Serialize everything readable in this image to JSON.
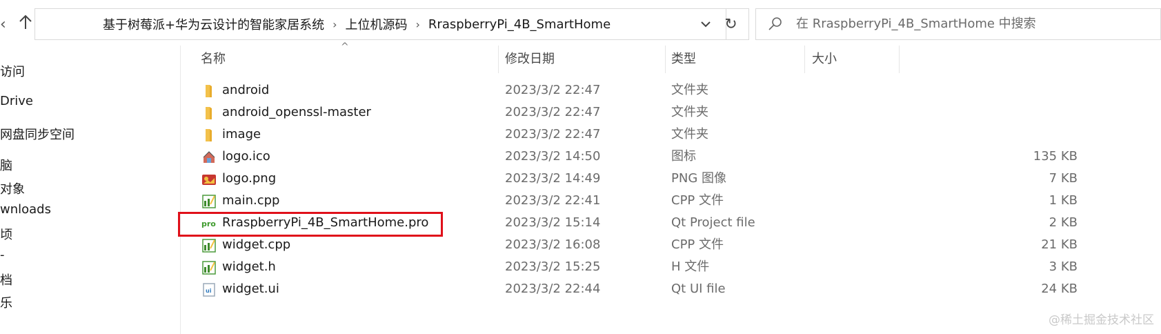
{
  "breadcrumb": {
    "items": [
      "基于树莓派+华为云设计的智能家居系统",
      "上位机源码",
      "RraspberryPi_4B_SmartHome"
    ],
    "separator": "›"
  },
  "search": {
    "placeholder": "在 RraspberryPi_4B_SmartHome 中搜索"
  },
  "icons": {
    "nav_up": "arrow-up-icon",
    "dropdown": "chevron-down-icon",
    "refresh": "refresh-icon",
    "search": "search-icon"
  },
  "nav_pane": {
    "items": [
      "访问",
      "Drive",
      "网盘同步空间",
      "脑",
      "对象",
      "wnloads",
      "顷",
      "-",
      "档",
      "乐"
    ]
  },
  "columns": {
    "name": "名称",
    "date": "修改日期",
    "type": "类型",
    "size": "大小"
  },
  "files": [
    {
      "name": "android",
      "date": "2023/3/2 22:47",
      "type": "文件夹",
      "size": "",
      "icon": "folder-icon"
    },
    {
      "name": "android_openssl-master",
      "date": "2023/3/2 22:47",
      "type": "文件夹",
      "size": "",
      "icon": "folder-icon"
    },
    {
      "name": "image",
      "date": "2023/3/2 22:47",
      "type": "文件夹",
      "size": "",
      "icon": "folder-icon"
    },
    {
      "name": "logo.ico",
      "date": "2023/3/2 14:50",
      "type": "图标",
      "size": "135 KB",
      "icon": "ico-file-icon"
    },
    {
      "name": "logo.png",
      "date": "2023/3/2 14:49",
      "type": "PNG 图像",
      "size": "7 KB",
      "icon": "png-file-icon"
    },
    {
      "name": "main.cpp",
      "date": "2023/3/2 22:41",
      "type": "CPP 文件",
      "size": "1 KB",
      "icon": "cpp-file-icon"
    },
    {
      "name": "RraspberryPi_4B_SmartHome.pro",
      "date": "2023/3/2 15:14",
      "type": "Qt Project file",
      "size": "2 KB",
      "icon": "pro-file-icon"
    },
    {
      "name": "widget.cpp",
      "date": "2023/3/2 16:08",
      "type": "CPP 文件",
      "size": "21 KB",
      "icon": "cpp-file-icon"
    },
    {
      "name": "widget.h",
      "date": "2023/3/2 15:25",
      "type": "H 文件",
      "size": "3 KB",
      "icon": "h-file-icon"
    },
    {
      "name": "widget.ui",
      "date": "2023/3/2 22:44",
      "type": "Qt UI file",
      "size": "24 KB",
      "icon": "ui-file-icon"
    }
  ],
  "watermark": "@稀土掘金技术社区",
  "colors": {
    "highlight": "#e0101a",
    "folder": "#f3c14b"
  }
}
